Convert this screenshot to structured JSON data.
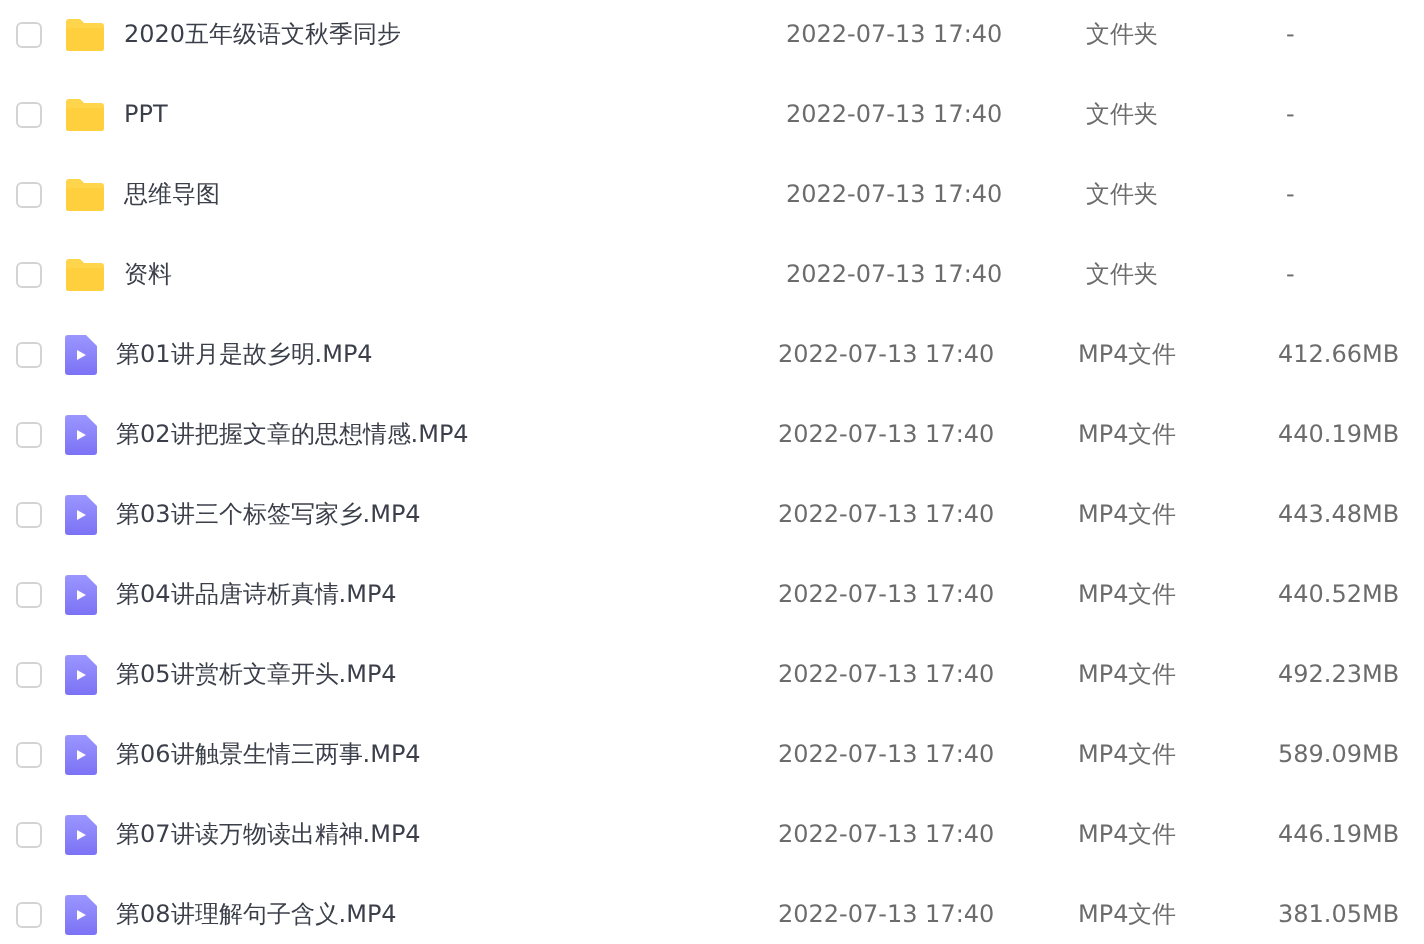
{
  "files": [
    {
      "kind": "folder",
      "checked": false,
      "name": "2020五年级语文秋季同步",
      "modified": "2022-07-13 17:40",
      "type": "文件夹",
      "size": "-"
    },
    {
      "kind": "folder",
      "checked": false,
      "name": "PPT",
      "modified": "2022-07-13 17:40",
      "type": "文件夹",
      "size": "-"
    },
    {
      "kind": "folder",
      "checked": false,
      "name": "思维导图",
      "modified": "2022-07-13 17:40",
      "type": "文件夹",
      "size": "-"
    },
    {
      "kind": "folder",
      "checked": false,
      "name": "资料",
      "modified": "2022-07-13 17:40",
      "type": "文件夹",
      "size": "-"
    },
    {
      "kind": "video",
      "checked": false,
      "name": "第01讲月是故乡明.MP4",
      "modified": "2022-07-13 17:40",
      "type": "MP4文件",
      "size": "412.66MB"
    },
    {
      "kind": "video",
      "checked": false,
      "name": "第02讲把握文章的思想情感.MP4",
      "modified": "2022-07-13 17:40",
      "type": "MP4文件",
      "size": "440.19MB"
    },
    {
      "kind": "video",
      "checked": false,
      "name": "第03讲三个标签写家乡.MP4",
      "modified": "2022-07-13 17:40",
      "type": "MP4文件",
      "size": "443.48MB"
    },
    {
      "kind": "video",
      "checked": false,
      "name": "第04讲品唐诗析真情.MP4",
      "modified": "2022-07-13 17:40",
      "type": "MP4文件",
      "size": "440.52MB"
    },
    {
      "kind": "video",
      "checked": false,
      "name": "第05讲赏析文章开头.MP4",
      "modified": "2022-07-13 17:40",
      "type": "MP4文件",
      "size": "492.23MB"
    },
    {
      "kind": "video",
      "checked": false,
      "name": "第06讲触景生情三两事.MP4",
      "modified": "2022-07-13 17:40",
      "type": "MP4文件",
      "size": "589.09MB"
    },
    {
      "kind": "video",
      "checked": false,
      "name": "第07讲读万物读出精神.MP4",
      "modified": "2022-07-13 17:40",
      "type": "MP4文件",
      "size": "446.19MB"
    },
    {
      "kind": "video",
      "checked": false,
      "name": "第08讲理解句子含义.MP4",
      "modified": "2022-07-13 17:40",
      "type": "MP4文件",
      "size": "381.05MB"
    }
  ]
}
